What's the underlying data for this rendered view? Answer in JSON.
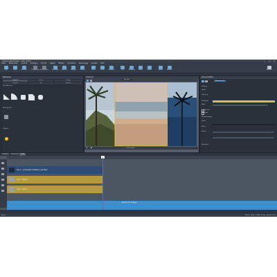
{
  "window": {
    "title": "Unbenanntes Projekt - Video Editor",
    "controls": [
      "—",
      "□",
      "✕"
    ]
  },
  "menu": [
    "Datei",
    "Bearbeiten",
    "Ansicht",
    "Einfügen",
    "Format",
    "Objekt",
    "Effekte",
    "Animation",
    "Werkzeuge",
    "Fenster",
    "Hilfe"
  ],
  "toolbar": [
    {
      "icon": "new-icon",
      "label": "Neu"
    },
    {
      "icon": "open-icon",
      "label": "Öffnen"
    },
    {
      "icon": "save-icon",
      "label": "Speichern"
    },
    {
      "icon": "undo-icon",
      "label": "Rückgängig"
    },
    {
      "icon": "redo-icon",
      "label": "Wiederholen"
    },
    {
      "icon": "cut-icon",
      "label": "Schneiden"
    },
    {
      "icon": "copy-icon",
      "label": "Kopieren"
    },
    {
      "icon": "paste-icon",
      "label": "Einfügen"
    },
    {
      "icon": "delete-icon",
      "label": "Löschen"
    },
    {
      "icon": "split-icon",
      "label": "Teilen"
    },
    {
      "icon": "zoom-icon",
      "label": "Zoom"
    },
    {
      "icon": "fit-icon",
      "label": "Anpassen"
    },
    {
      "icon": "title-icon",
      "label": "Titel"
    },
    {
      "icon": "transition-icon",
      "label": "Übergang"
    },
    {
      "icon": "music-icon",
      "label": "Musik"
    },
    {
      "icon": "effects-icon",
      "label": "Effekte"
    },
    {
      "icon": "export-icon",
      "label": "Export"
    },
    {
      "icon": "render-icon",
      "label": "Rendern"
    }
  ],
  "toolbar_right": {
    "icon": "user-icon",
    "label": "Benutzer"
  },
  "library": {
    "title": "Bibliothek",
    "tabs": [
      "Formen",
      "Linien",
      "Pfeile",
      "Objekte",
      "Text",
      "Medien"
    ],
    "section1": "Grundformen",
    "section2": "Hintergrund",
    "section3": "Objekte"
  },
  "preview": {
    "title": "Vorschau",
    "toolbar_label": "Auswahl",
    "controls_label": "00:00:00:00"
  },
  "properties": {
    "title": "Eigenschaften",
    "button": "Übernehmen",
    "rows": [
      "Position",
      "Größe",
      "Drehung",
      "Deckkraft",
      "Rand",
      "Schatten",
      "Effekt",
      "Überblendung",
      "Dauer",
      "Farbe",
      "Stärke",
      "Weichheit"
    ]
  },
  "timeline": {
    "tabs": [
      "Zeitleiste",
      "Storyboard",
      "Audio"
    ],
    "tracks": [
      {
        "label": "Clip 1 - Landschaft mit Palmen und Meer",
        "color": "#2f4a73"
      },
      {
        "label": "Clip 2 - Strand",
        "color": "#b59a3e"
      },
      {
        "label": "Clip 3 - Strand",
        "color": "#b59a3e"
      },
      {
        "label": "",
        "color": "#3b8fd0"
      }
    ],
    "center_note": "Objekte hier ablegen"
  },
  "status": {
    "left": "Bereit",
    "right": "100%  |  1920 x 1080  |  25 fps  |  00:00:12:15"
  }
}
